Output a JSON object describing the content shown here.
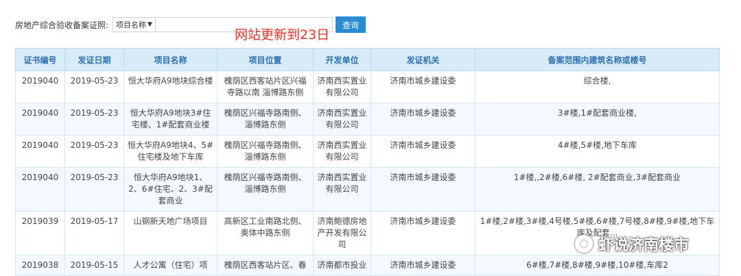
{
  "search": {
    "label": "房地产综合验收备案证照:",
    "select_value": "项目名称",
    "input_value": "",
    "button_label": "查询"
  },
  "notice": "网站更新到23日",
  "table": {
    "headers": [
      "证书编号",
      "发证日期",
      "项目名称",
      "项目位置",
      "开发单位",
      "发证机关",
      "备案范围内建筑名称或楼号"
    ],
    "rows": [
      [
        "2019040",
        "2019-05-23",
        "恒大华府A9地块综合楼",
        "槐荫区西客站片区兴福寺路以南 淄博路东侧",
        "济南西实置业有限公司",
        "济南市城乡建设委",
        "综合楼,"
      ],
      [
        "2019040",
        "2019-05-23",
        "恒大华府A9地块3#住宅楼、1#配套商业楼",
        "槐荫区兴福寺路南侧、淄博路东侧",
        "济南西实置业有限公司",
        "济南市城乡建设委",
        "3#楼,1#配套商业楼,"
      ],
      [
        "2019040",
        "2019-05-23",
        "恒大华府A9地块4、5#住宅楼及地下车库",
        "槐荫区兴福寺路南侧、淄博路东侧",
        "济南西实置业有限公司",
        "济南市城乡建设委",
        "4#楼,5#楼,地下车库"
      ],
      [
        "2019040",
        "2019-05-23",
        "恒大华府A9地块1、2、6#住宅、2、3#配套商业",
        "槐荫区兴福寺路南侧、淄博路东侧",
        "济南西实置业有限公司",
        "济南市城乡建设委",
        "1#楼,,2#楼,6#楼, 2#配套商业,3#配套商业"
      ],
      [
        "2019039",
        "2019-05-17",
        "山钢新天地广场项目",
        "高新区工业南路北侧、奥体中路东侧",
        "济南鲍德房地产开发有限公司",
        "济南市城乡建设委",
        "1#楼,2#楼,3#楼,4号楼,5#楼,6#楼,7号楼,8#楼,9#楼,地下车库及配套..."
      ],
      [
        "2019038",
        "2019-05-15",
        "人才公寓（住宅）项",
        "槐荫区西客站片区、春",
        "济南都市投业",
        "济南市城乡建设委",
        "6#楼,7#楼,8#楼,9#楼,10#楼,车库2"
      ]
    ]
  },
  "watermark": {
    "text": "虾说济南楼市",
    "icon": "wechat-logo-icon"
  },
  "colors": {
    "header_bg": "#d7ebf9",
    "header_text": "#2d70b0",
    "button_bg": "#2a8bd4",
    "notice_red": "#e8352b"
  }
}
